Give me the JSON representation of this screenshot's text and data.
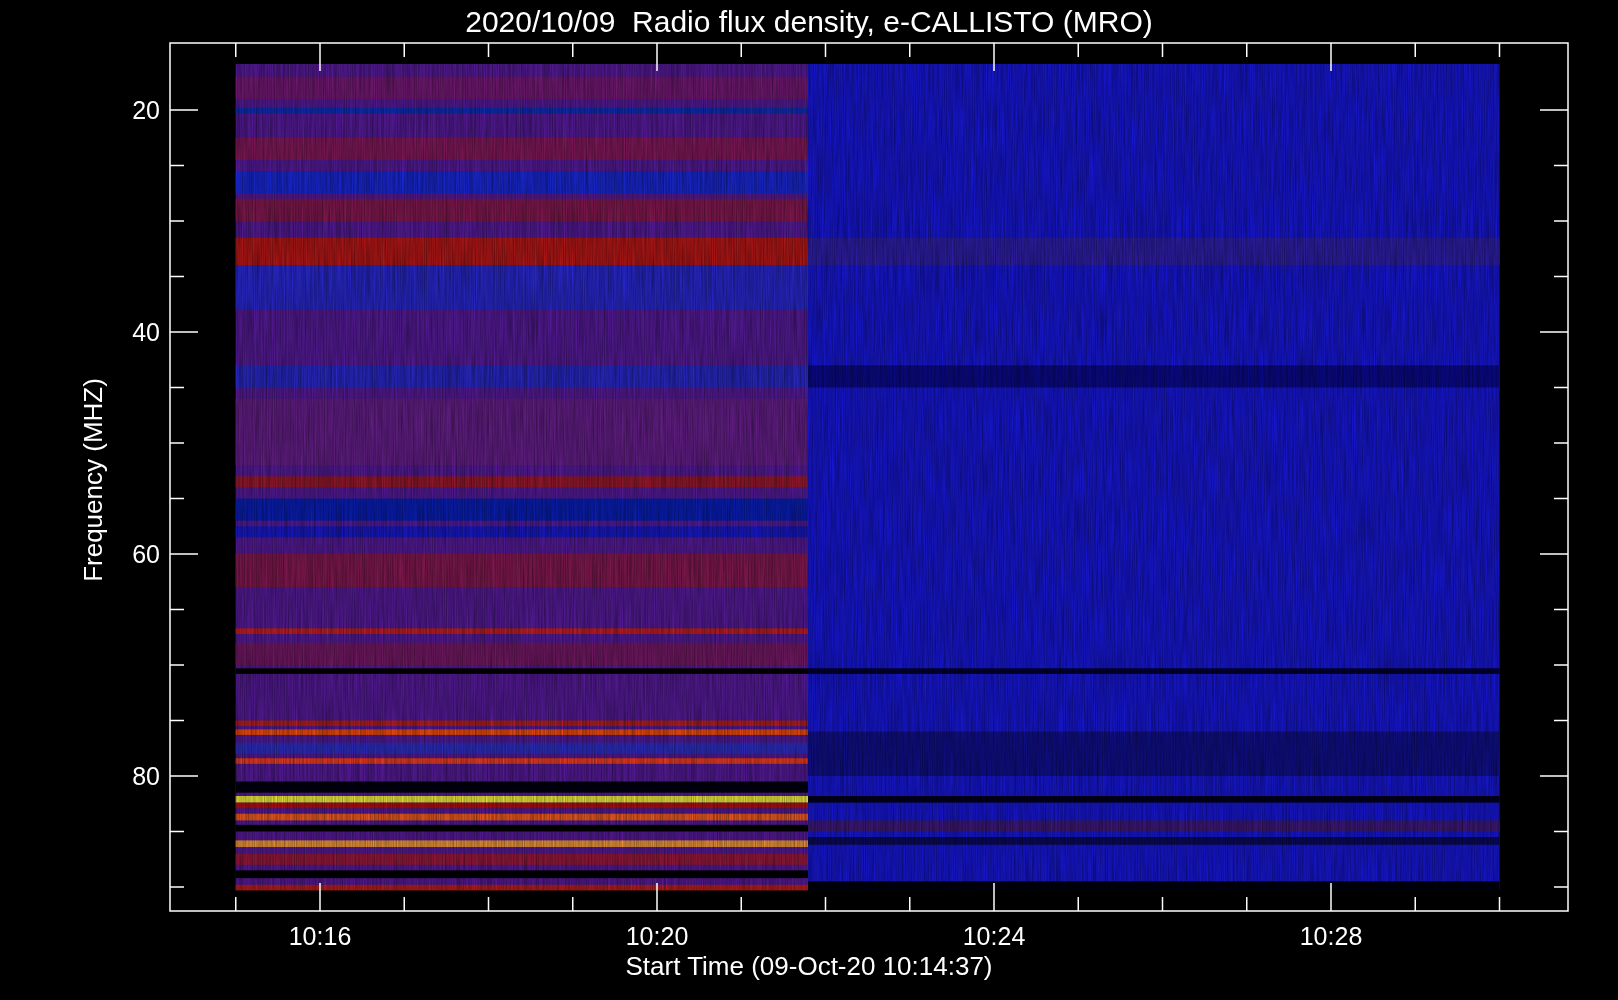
{
  "plot": {
    "title": "2020/10/09  Radio flux density, e-CALLISTO (MRO)",
    "x_axis": {
      "label": "Start Time (09-Oct-20 10:14:37)",
      "ticks": [
        "10:16",
        "10:20",
        "10:24",
        "10:28"
      ]
    },
    "y_axis": {
      "label": "Frequency (MHZ)",
      "ticks": [
        "20",
        "40",
        "60",
        "80"
      ]
    }
  }
}
